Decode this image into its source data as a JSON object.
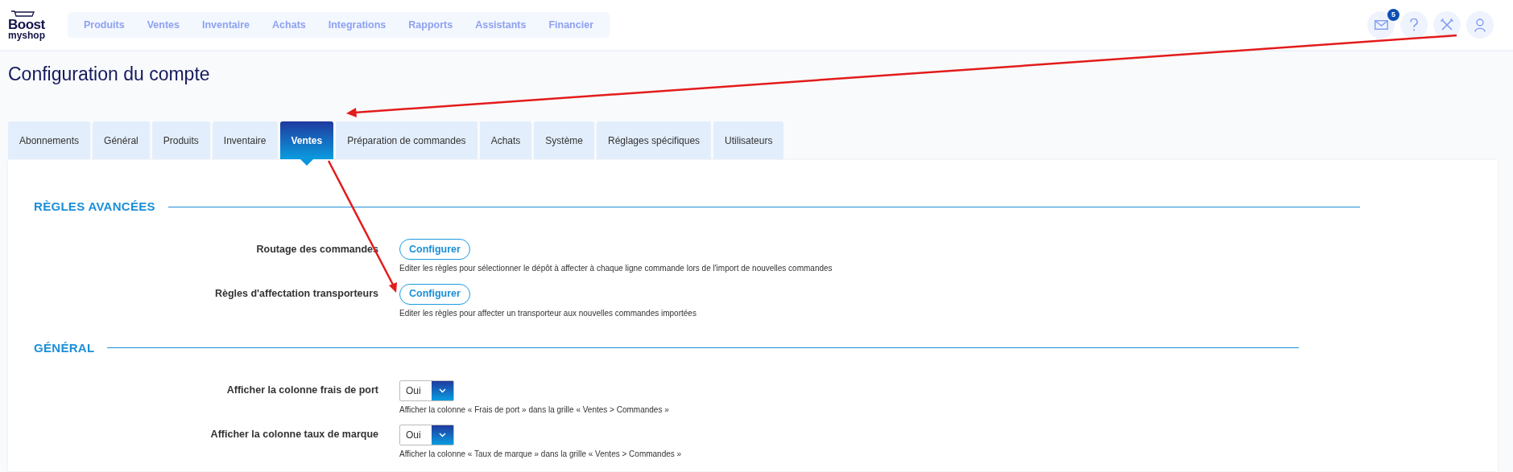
{
  "logo": {
    "line1": "Boost",
    "line2": "myshop"
  },
  "nav": [
    {
      "label": "Produits"
    },
    {
      "label": "Ventes"
    },
    {
      "label": "Inventaire"
    },
    {
      "label": "Achats"
    },
    {
      "label": "Integrations"
    },
    {
      "label": "Rapports"
    },
    {
      "label": "Assistants"
    },
    {
      "label": "Financier"
    }
  ],
  "header_icons": {
    "messages_badge": "5"
  },
  "page_title": "Configuration du compte",
  "tabs": [
    {
      "label": "Abonnements",
      "selected": false
    },
    {
      "label": "Général",
      "selected": false
    },
    {
      "label": "Produits",
      "selected": false
    },
    {
      "label": "Inventaire",
      "selected": false
    },
    {
      "label": "Ventes",
      "selected": true
    },
    {
      "label": "Préparation de commandes",
      "selected": false
    },
    {
      "label": "Achats",
      "selected": false
    },
    {
      "label": "Système",
      "selected": false
    },
    {
      "label": "Réglages spécifiques",
      "selected": false
    },
    {
      "label": "Utilisateurs",
      "selected": false
    }
  ],
  "sections": [
    {
      "title": "RÈGLES AVANCÉES",
      "rows": [
        {
          "kind": "button",
          "label": "Routage des commandes",
          "button": "Configurer",
          "help": "Editer les règles pour sélectionner le dépôt à affecter à chaque ligne commande lors de l'import de nouvelles commandes"
        },
        {
          "kind": "button",
          "label": "Règles d'affectation transporteurs",
          "button": "Configurer",
          "help": "Editer les règles pour affecter un transporteur aux nouvelles commandes importées"
        }
      ]
    },
    {
      "title": "GÉNÉRAL",
      "rows": [
        {
          "kind": "select",
          "label": "Afficher la colonne frais de port",
          "value": "Oui",
          "help": "Afficher la colonne « Frais de port » dans la grille « Ventes > Commandes »"
        },
        {
          "kind": "select",
          "label": "Afficher la colonne taux de marque",
          "value": "Oui",
          "help": "Afficher la colonne « Taux de marque » dans la grille « Ventes > Commandes »"
        }
      ]
    }
  ]
}
